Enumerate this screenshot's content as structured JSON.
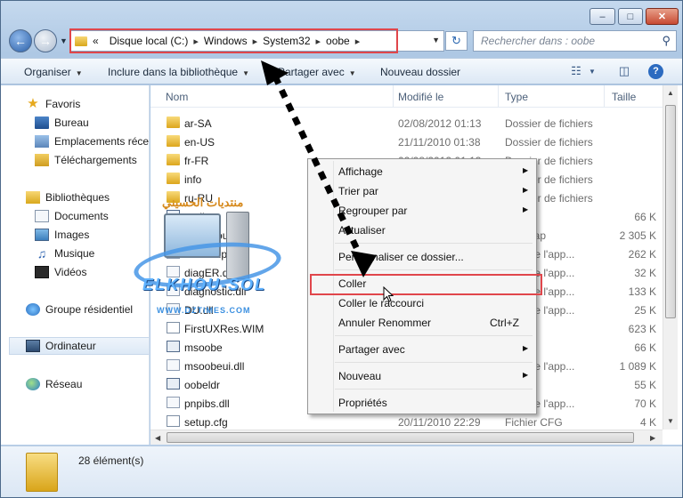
{
  "address": {
    "prefix_glyph": "«",
    "crumbs": [
      "Disque local (C:)",
      "Windows",
      "System32",
      "oobe"
    ]
  },
  "search": {
    "placeholder": "Rechercher dans : oobe"
  },
  "toolbar": {
    "organize": "Organiser",
    "include_library": "Inclure dans la bibliothèque",
    "share_with": "Partager avec",
    "new_folder": "Nouveau dossier"
  },
  "sidebar": {
    "favorites": "Favoris",
    "desktop": "Bureau",
    "recent_places": "Emplacements récents",
    "downloads": "Téléchargements",
    "libraries": "Bibliothèques",
    "documents": "Documents",
    "images": "Images",
    "music": "Musique",
    "videos": "Vidéos",
    "homegroup": "Groupe résidentiel",
    "computer": "Ordinateur",
    "network": "Réseau"
  },
  "columns": {
    "name": "Nom",
    "modified": "Modifié le",
    "type": "Type",
    "size": "Taille"
  },
  "files": [
    {
      "name": "ar-SA",
      "date": "02/08/2012 01:13",
      "type": "Dossier de fichiers",
      "size": ""
    },
    {
      "name": "en-US",
      "date": "21/11/2010 01:38",
      "type": "Dossier de fichiers",
      "size": ""
    },
    {
      "name": "fr-FR",
      "date": "02/08/2012 01:13",
      "type": "Dossier de fichiers",
      "size": ""
    },
    {
      "name": "info",
      "date": "",
      "type": "Dossier de fichiers",
      "size": ""
    },
    {
      "name": "ru-RU",
      "date": "",
      "type": "Dossier de fichiers",
      "size": ""
    },
    {
      "name": "audit",
      "date": "",
      "type": "...ation",
      "size": "66 K"
    },
    {
      "name": "background",
      "date": "",
      "type": "...bitmap",
      "size": "2 305 K"
    },
    {
      "name": "cmisetup.dll",
      "date": "",
      "type": "...on de l'app...",
      "size": "262 K"
    },
    {
      "name": "diagER.dll",
      "date": "",
      "type": "...on de l'app...",
      "size": "32 K"
    },
    {
      "name": "diagnostic.dll",
      "date": "",
      "type": "...on de l'app...",
      "size": "133 K"
    },
    {
      "name": "DU.dll",
      "date": "",
      "type": "...on de l'app...",
      "size": "25 K"
    },
    {
      "name": "FirstUXRes.WIM",
      "date": "",
      "type": "...WIM",
      "size": "623 K"
    },
    {
      "name": "msoobe",
      "date": "",
      "type": "...ation",
      "size": "66 K"
    },
    {
      "name": "msoobeui.dll",
      "date": "",
      "type": "...on de l'app...",
      "size": "1 089 K"
    },
    {
      "name": "oobeldr",
      "date": "",
      "type": "...ation",
      "size": "55 K"
    },
    {
      "name": "pnpibs.dll",
      "date": "",
      "type": "...on de l'app...",
      "size": "70 K"
    },
    {
      "name": "setup.cfg",
      "date": "20/11/2010 22:29",
      "type": "Fichier CFG",
      "size": "4 K"
    }
  ],
  "status": {
    "count": "28 élément(s)"
  },
  "context_menu": {
    "view": "Affichage",
    "sort_by": "Trier par",
    "group_by": "Regrouper par",
    "refresh": "Actualiser",
    "customize": "Personnaliser ce dossier...",
    "paste": "Coller",
    "paste_shortcut": "Coller le raccourci",
    "undo_rename": "Annuler Renommer",
    "undo_shortcut": "Ctrl+Z",
    "share_with": "Partager avec",
    "new": "Nouveau",
    "properties": "Propriétés"
  },
  "watermark": {
    "arabic": "منتديات الحسيني",
    "brand": "ELKHOU-SOL",
    "url": "WWW.DZTIMES.COM"
  },
  "colors": {
    "highlight": "#e0464b",
    "accent": "#2a5fa8"
  }
}
